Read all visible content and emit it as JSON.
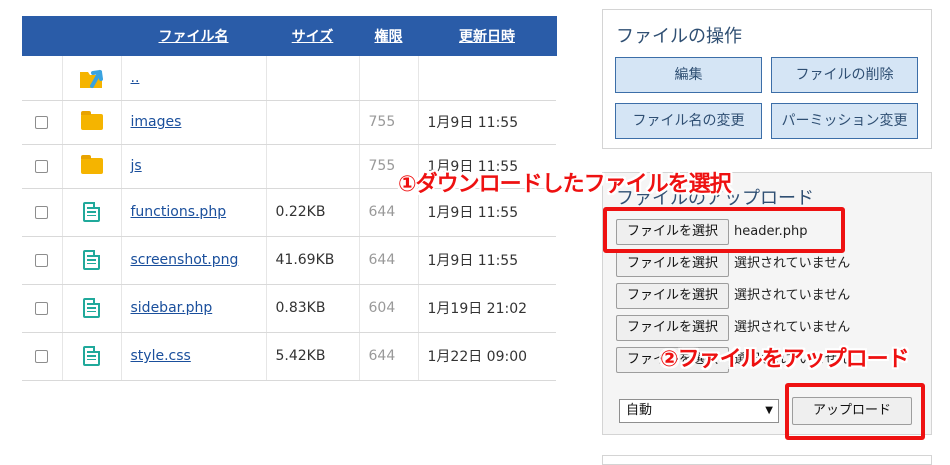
{
  "table": {
    "headers": {
      "name": "ファイル名",
      "size": "サイズ",
      "perm": "権限",
      "date": "更新日時"
    },
    "parent": {
      "name": ".."
    },
    "rows": [
      {
        "name": "images",
        "size": "",
        "perm": "755",
        "date": "1月9日 11:55",
        "icon": "folder-icon"
      },
      {
        "name": "js",
        "size": "",
        "perm": "755",
        "date": "1月9日 11:55",
        "icon": "folder-icon"
      },
      {
        "name": "functions.php",
        "size": "0.22KB",
        "perm": "644",
        "date": "1月9日 11:55",
        "icon": "file-icon"
      },
      {
        "name": "screenshot.png",
        "size": "41.69KB",
        "perm": "644",
        "date": "1月9日 11:55",
        "icon": "file-icon"
      },
      {
        "name": "sidebar.php",
        "size": "0.83KB",
        "perm": "604",
        "date": "1月19日 21:02",
        "icon": "file-icon"
      },
      {
        "name": "style.css",
        "size": "5.42KB",
        "perm": "644",
        "date": "1月22日 09:00",
        "icon": "file-icon"
      }
    ]
  },
  "operations": {
    "title": "ファイルの操作",
    "edit": "編集",
    "delete": "ファイルの削除",
    "rename": "ファイル名の変更",
    "permission": "パーミッション変更"
  },
  "upload": {
    "title": "ファイルのアップロード",
    "choose_label": "ファイルを選択",
    "files": [
      "header.php",
      "選択されていません",
      "選択されていません",
      "選択されていません",
      "選択されていません"
    ],
    "mode": "自動",
    "submit": "アップロード"
  },
  "annotations": {
    "step1": "①ダウンロードしたファイルを選択",
    "step2": "②ファイルをアップロード"
  },
  "colors": {
    "header_bg": "#2a5ca8",
    "accent_red": "#ee1111",
    "button_bg": "#d5e5f5"
  }
}
